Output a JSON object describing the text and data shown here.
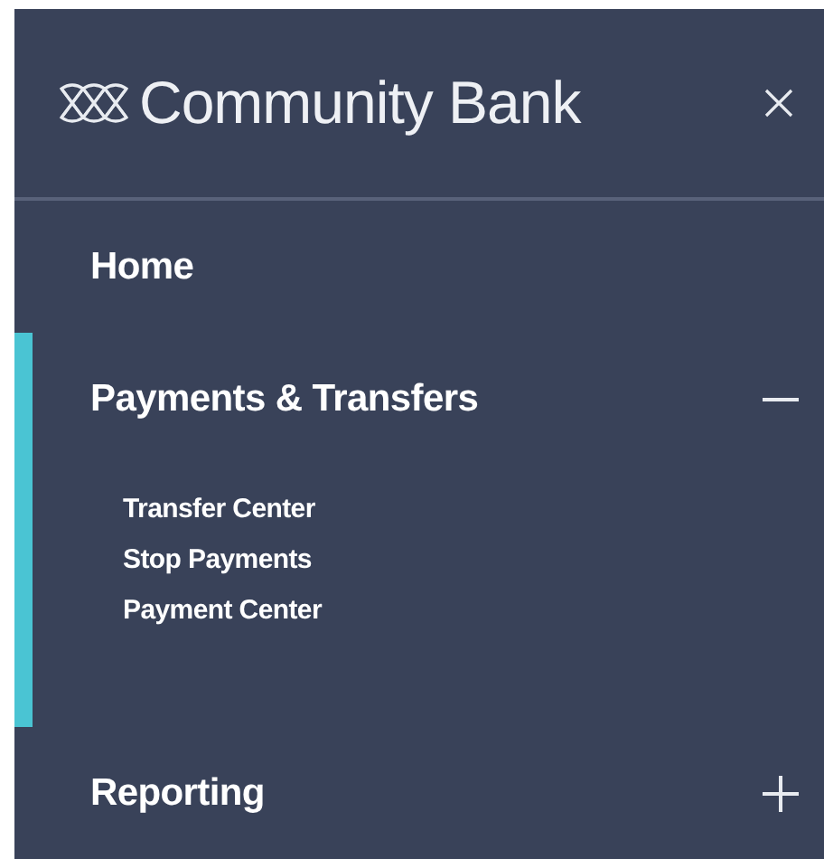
{
  "brand": {
    "name": "Community Bank"
  },
  "nav": [
    {
      "kind": "link",
      "label": "Home",
      "selected": false
    },
    {
      "kind": "group",
      "label": "Payments & Transfers",
      "selected": true,
      "expanded": true,
      "children": [
        {
          "label": "Transfer Center"
        },
        {
          "label": "Stop Payments"
        },
        {
          "label": "Payment Center"
        }
      ]
    },
    {
      "kind": "group",
      "label": "Reporting",
      "selected": false,
      "expanded": false
    }
  ]
}
